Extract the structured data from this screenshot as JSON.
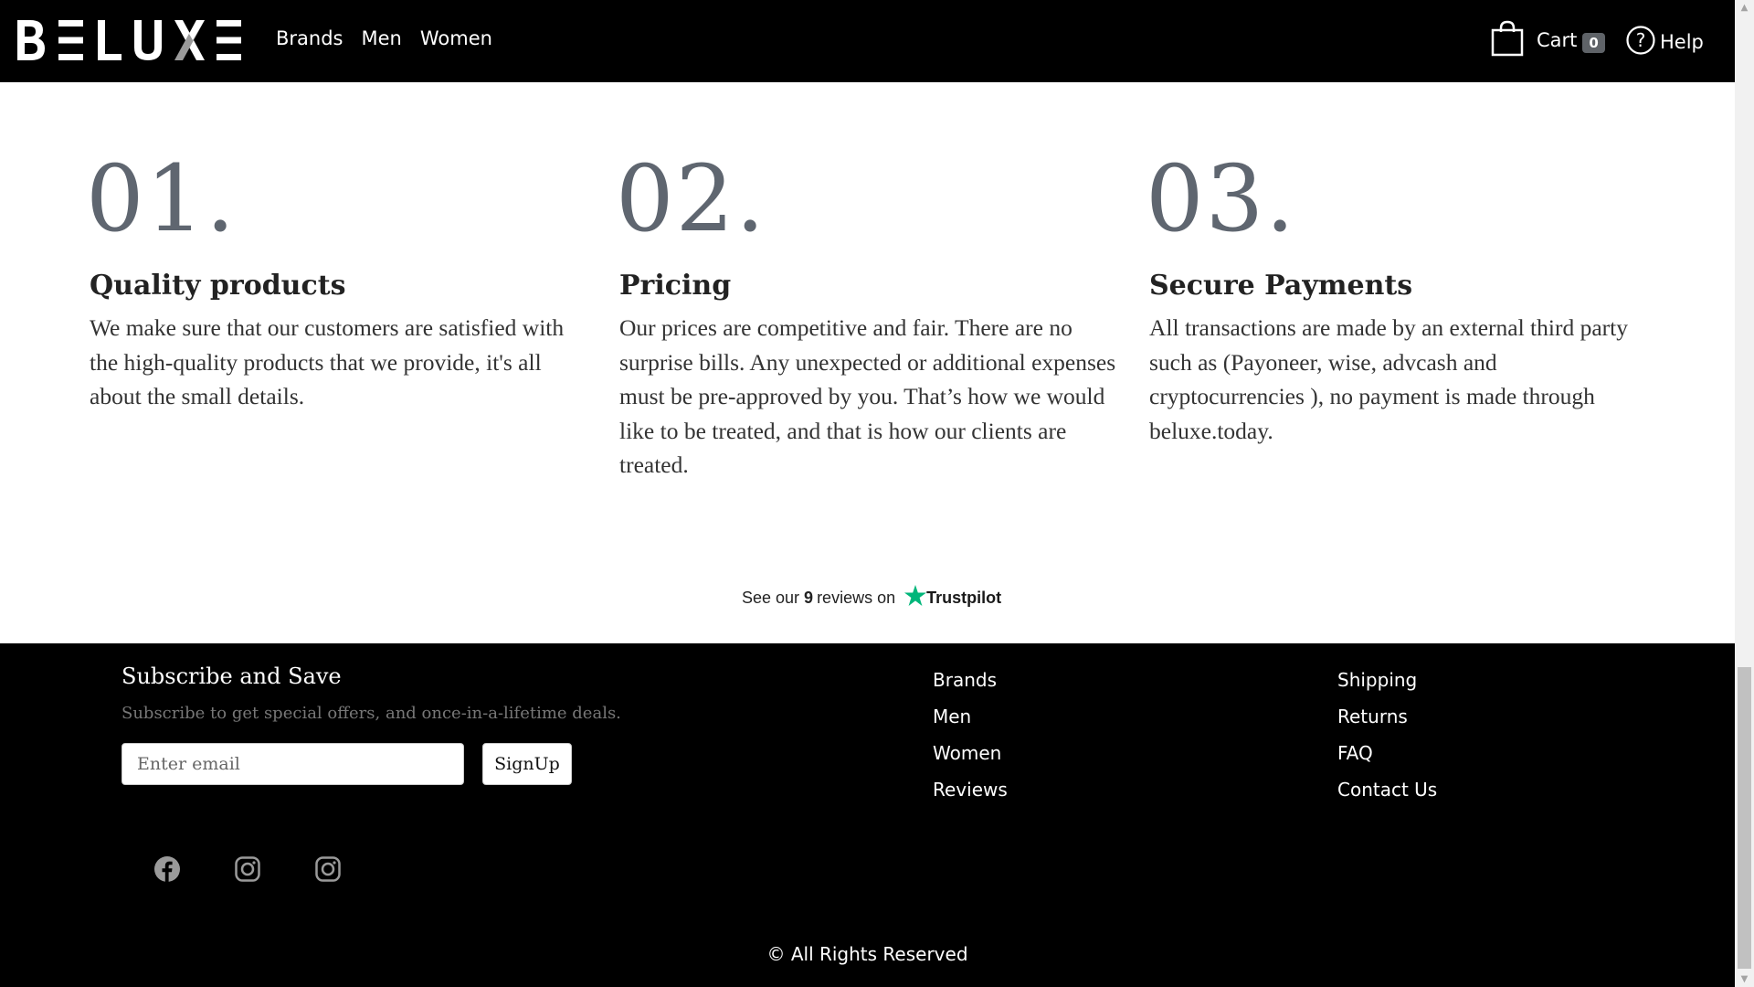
{
  "header": {
    "logo_text": "BELUXE",
    "nav": [
      {
        "label": "Brands"
      },
      {
        "label": "Men"
      },
      {
        "label": "Women"
      }
    ],
    "cart": {
      "label": "Cart",
      "count": "0",
      "icon": "shopping-bag-icon"
    },
    "help": {
      "label": "Help",
      "icon": "question-circle-icon"
    }
  },
  "features": [
    {
      "number": "01.",
      "title": "Quality products",
      "text": "We make sure that our customers are satisfied with the high-quality products that we provide, it's all about the small details."
    },
    {
      "number": "02.",
      "title": "Pricing",
      "text": "Our prices are competitive and fair. There are no surprise bills. Any unexpected or additional expenses must be pre-approved by you. That’s how we would like to be treated, and that is how our clients are treated."
    },
    {
      "number": "03.",
      "title": "Secure Payments",
      "text": "All transactions are made by an external third party such as (Payoneer, wise, advcash and cryptocurrencies ), no payment is made through beluxe.today."
    }
  ],
  "trustpilot": {
    "prefix": "See our",
    "count": "9",
    "suffix": "reviews on",
    "brand": "Trustpilot",
    "star_color": "#00b67a"
  },
  "footer": {
    "subscribe_title": "Subscribe and Save",
    "subscribe_desc": "Subscribe to get special offers, and once-in-a-lifetime deals.",
    "email_placeholder": "Enter email",
    "signup_label": "SignUp",
    "links_col1": [
      "Brands",
      "Men",
      "Women",
      "Reviews"
    ],
    "links_col2": [
      "Shipping",
      "Returns",
      "FAQ",
      "Contact Us"
    ],
    "social_icons": [
      "facebook-icon",
      "instagram-icon",
      "instagram-icon"
    ],
    "copyright": "© All Rights Reserved"
  },
  "colors": {
    "header_bg": "#000000",
    "footer_bg": "#000000",
    "feature_number": "#5f6670",
    "social_icon": "#9a9a9a"
  }
}
